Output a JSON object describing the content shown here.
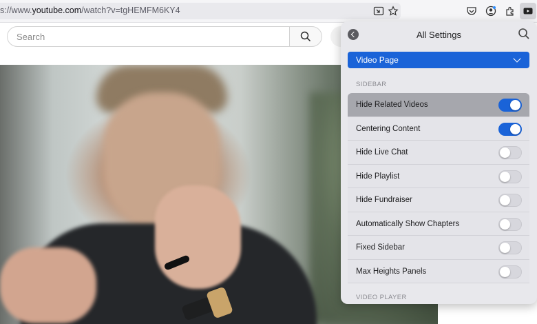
{
  "browser": {
    "url_prefix": "s://www.",
    "url_domain": "youtube.com",
    "url_path": "/watch?v=tgHEMFM6KY4"
  },
  "youtube": {
    "search_placeholder": "Search"
  },
  "settings_panel": {
    "title": "All Settings",
    "page_selector": "Video Page",
    "section_sidebar": "SIDEBAR",
    "section_next": "VIDEO PLAYER",
    "items": [
      {
        "label": "Hide Related Videos",
        "enabled": true
      },
      {
        "label": "Centering Content",
        "enabled": true
      },
      {
        "label": "Hide Live Chat",
        "enabled": false
      },
      {
        "label": "Hide Playlist",
        "enabled": false
      },
      {
        "label": "Hide Fundraiser",
        "enabled": false
      },
      {
        "label": "Automatically Show Chapters",
        "enabled": false
      },
      {
        "label": "Fixed Sidebar",
        "enabled": false
      },
      {
        "label": "Max Heights Panels",
        "enabled": false
      }
    ]
  },
  "colors": {
    "accent": "#1a63d8",
    "panel_bg": "#e8e8ec"
  }
}
